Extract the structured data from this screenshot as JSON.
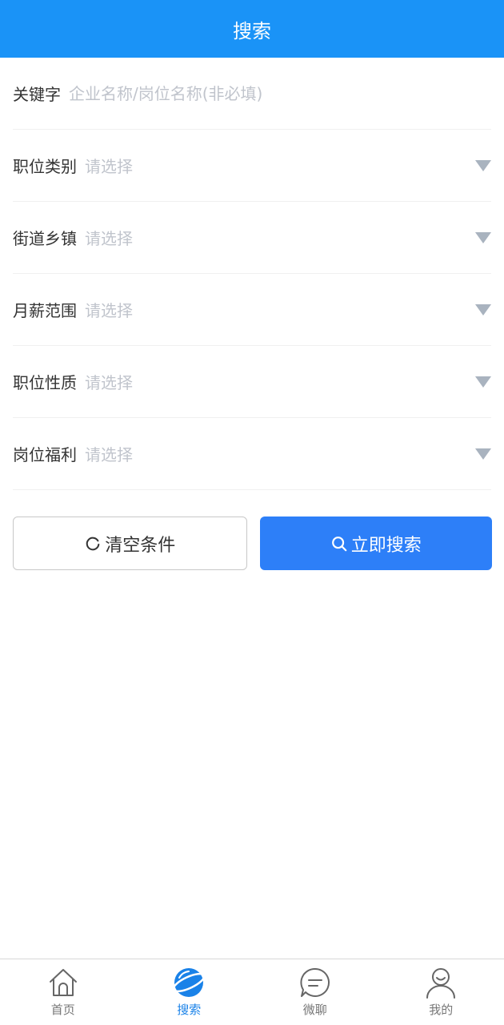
{
  "header": {
    "title": "搜索"
  },
  "form": {
    "keyword": {
      "label": "关键字",
      "placeholder": "企业名称/岗位名称(非必填)"
    },
    "rows": [
      {
        "label": "职位类别",
        "placeholder": "请选择"
      },
      {
        "label": "街道乡镇",
        "placeholder": "请选择"
      },
      {
        "label": "月薪范围",
        "placeholder": "请选择"
      },
      {
        "label": "职位性质",
        "placeholder": "请选择"
      },
      {
        "label": "岗位福利",
        "placeholder": "请选择"
      }
    ]
  },
  "actions": {
    "clear_label": "清空条件",
    "search_label": "立即搜索"
  },
  "tabbar": {
    "items": [
      {
        "label": "首页",
        "icon": "home-icon"
      },
      {
        "label": "搜索",
        "icon": "planet-icon",
        "active": true
      },
      {
        "label": "微聊",
        "icon": "chat-icon"
      },
      {
        "label": "我的",
        "icon": "user-icon"
      }
    ]
  },
  "colors": {
    "header": "#1a93f7",
    "primary_button": "#2d7ff8",
    "active_tab": "#1a82e8",
    "placeholder": "#c0c4cc"
  }
}
